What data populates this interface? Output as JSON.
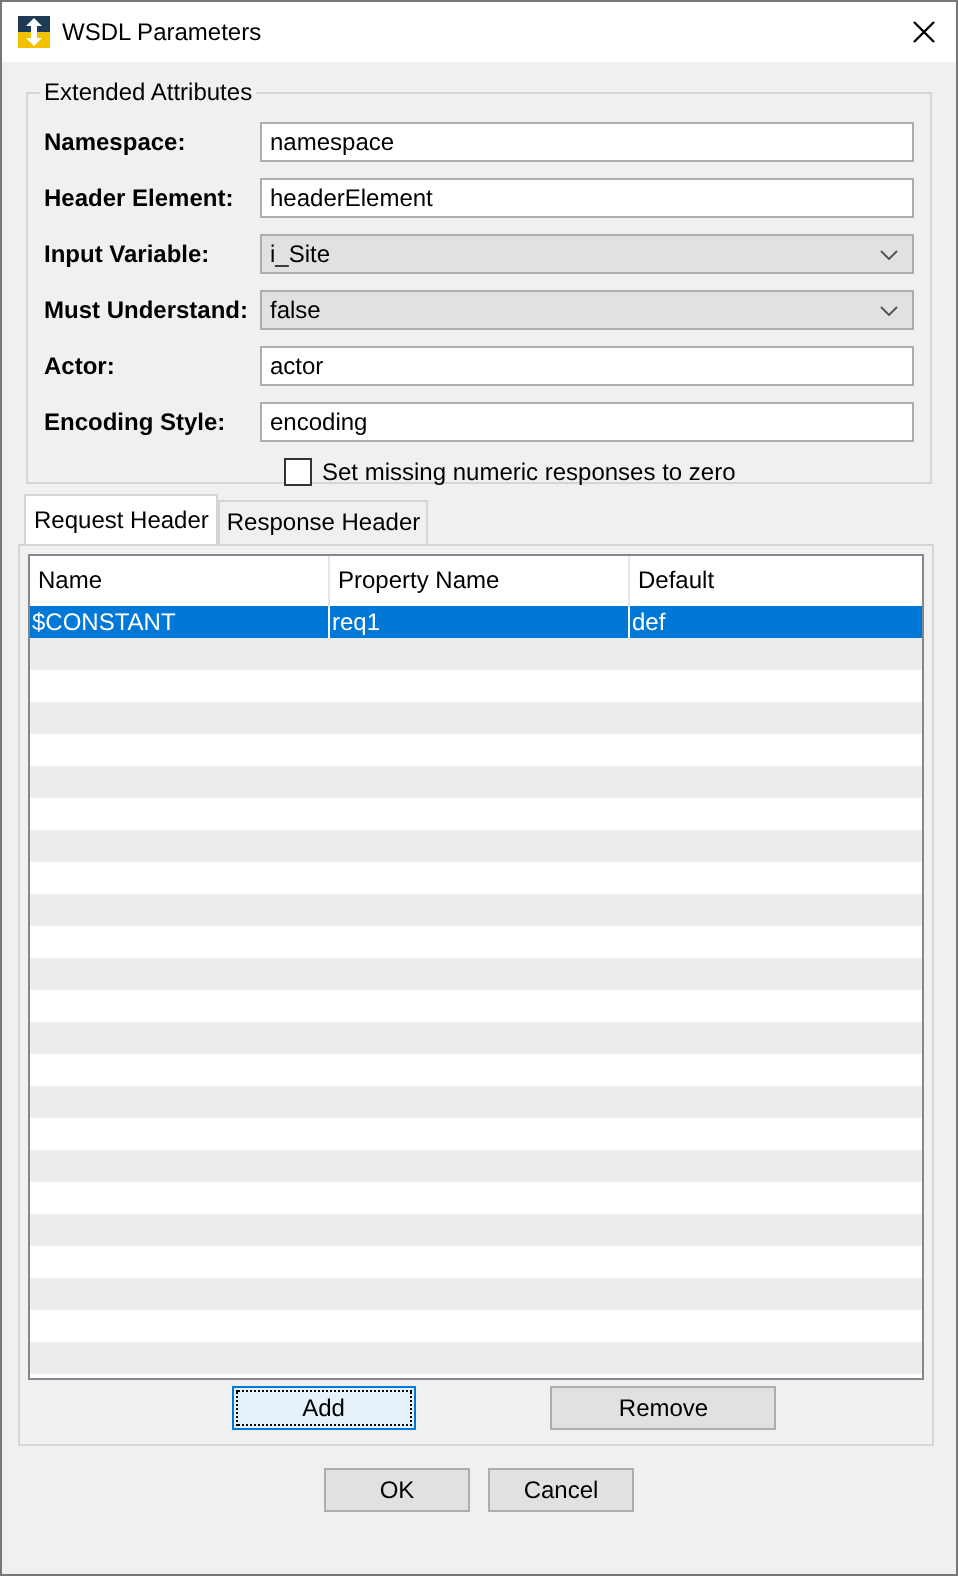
{
  "window": {
    "title": "WSDL Parameters"
  },
  "group": {
    "title": "Extended Attributes",
    "fields": [
      {
        "label": "Namespace:",
        "kind": "text",
        "value": "namespace"
      },
      {
        "label": "Header Element:",
        "kind": "text",
        "value": "headerElement"
      },
      {
        "label": "Input Variable:",
        "kind": "select",
        "value": "i_Site"
      },
      {
        "label": "Must Understand:",
        "kind": "select",
        "value": "false"
      },
      {
        "label": "Actor:",
        "kind": "text",
        "value": "actor"
      },
      {
        "label": "Encoding Style:",
        "kind": "text",
        "value": "encoding"
      }
    ],
    "checkbox": {
      "label": "Set missing numeric responses to zero",
      "checked": false
    }
  },
  "tabs": [
    {
      "label": "Request Header",
      "selected": true
    },
    {
      "label": "Response Header",
      "selected": false
    }
  ],
  "table": {
    "columns": [
      "Name",
      "Property Name",
      "Default"
    ],
    "rows": [
      {
        "cells": [
          "$CONSTANT",
          "req1",
          "def"
        ],
        "selected": true
      }
    ]
  },
  "table_buttons": [
    {
      "label": "Add",
      "focused": true
    },
    {
      "label": "Remove",
      "focused": false
    }
  ],
  "buttons": [
    "OK",
    "Cancel"
  ]
}
